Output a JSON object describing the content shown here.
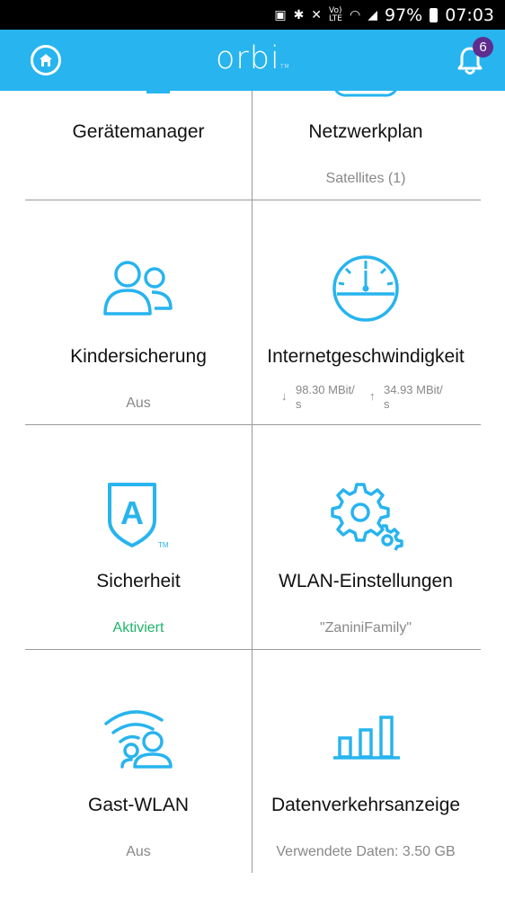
{
  "status_bar": {
    "battery": "97%",
    "time": "07:03"
  },
  "header": {
    "logo": "orbi",
    "logo_tm": "TM",
    "notification_count": "6"
  },
  "tiles": {
    "device_manager": {
      "title": "Gerätemanager"
    },
    "network_map": {
      "title": "Netzwerkplan",
      "subtitle": "Satellites (1)"
    },
    "parental_controls": {
      "title": "Kindersicherung",
      "subtitle": "Aus"
    },
    "internet_speed": {
      "title": "Internetgeschwindigkeit",
      "download": "98.30 MBit/",
      "download_unit": "s",
      "upload": "34.93 MBit/",
      "upload_unit": "s"
    },
    "security": {
      "title": "Sicherheit",
      "subtitle": "Aktiviert",
      "shield_letter": "A",
      "shield_tm": "TM"
    },
    "wifi_settings": {
      "title": "WLAN-Einstellungen",
      "subtitle": "\"ZaniniFamily\""
    },
    "guest_wifi": {
      "title": "Gast-WLAN",
      "subtitle": "Aus"
    },
    "traffic_meter": {
      "title": "Datenverkehrsanzeige",
      "subtitle": "Verwendete Daten: 3.50 GB"
    }
  },
  "colors": {
    "header": "#27b4ef",
    "icon": "#27b4ef",
    "active_green": "#1fb36a",
    "badge": "#5e2d8f"
  }
}
